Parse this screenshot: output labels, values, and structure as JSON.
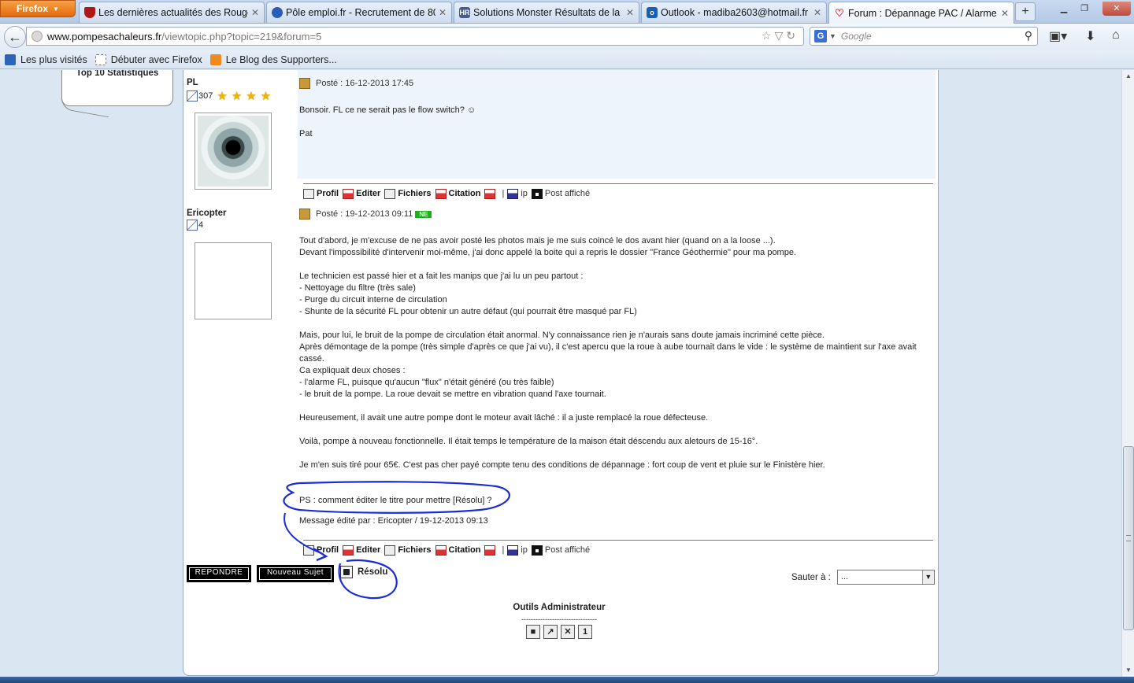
{
  "browser": {
    "menu_label": "Firefox",
    "tabs": [
      {
        "title": "Les dernières actualités des Rouge ...",
        "icon": "shield-red"
      },
      {
        "title": "Pôle emploi.fr - Recrutement de 80...",
        "icon": "page-blue"
      },
      {
        "title": "Solutions Monster Résultats de la r...",
        "icon": "hr-badge",
        "icon_text": "HR"
      },
      {
        "title": "Outlook - madiba2603@hotmail.fr",
        "icon": "outlook-icon",
        "icon_text": "o"
      },
      {
        "title": "Forum : Dépannage PAC / Alarme ...",
        "icon": "heart-icon",
        "active": true
      }
    ],
    "new_tab": "+",
    "url_domain": "www.pompesachaleurs.fr",
    "url_path": "/viewtopic.php?topic=219&forum=5",
    "search_placeholder": "Google",
    "search_engine_icon": "G",
    "bookmarks": [
      "Les plus visités",
      "Débuter avec Firefox",
      "Le Blog des Supporters..."
    ]
  },
  "sidebar_note": "Top 10  Statistiques",
  "posts": [
    {
      "author": "PL",
      "post_count": "307",
      "stars": 4,
      "posted": "Posté : 16-12-2013 17:45",
      "body": [
        "Bonsoir. FL ce ne serait pas le flow switch? ☺",
        "",
        "Pat"
      ]
    },
    {
      "author": "Ericopter",
      "post_count": "4",
      "posted": "Posté : 19-12-2013 09:11",
      "badge": "NE",
      "body": [
        "Tout d'abord, je m'excuse de ne pas avoir posté les photos mais je me suis coincé le dos avant hier (quand on a la loose ...).",
        "Devant l'impossibilité d'intervenir moi-même, j'ai donc appelé la boite qui a repris le dossier \"France Géothermie\" pour ma pompe.",
        "",
        "Le technicien est passé hier et a fait les manips que j'ai lu un peu partout :",
        "- Nettoyage du filtre (très sale)",
        "- Purge du circuit interne de circulation",
        "- Shunte de la sécurité FL pour obtenir un autre défaut (qui pourrait être masqué par FL)",
        "",
        "Mais, pour lui, le bruit de la pompe de circulation était anormal. N'y connaissance rien je n'aurais sans doute jamais incriminé cette pièce.",
        "Après démontage de la pompe (très simple d'après ce que j'ai vu), il c'est apercu que la roue à aube tournait dans le vide : le système de maintient sur l'axe avait",
        "cassé.",
        "Ca expliquait deux choses :",
        "- l'alarme FL, puisque qu'aucun \"flux\" n'était généré (ou très faible)",
        "- le bruit de la pompe. La roue devait se mettre en vibration quand l'axe tournait.",
        "",
        "Heureusement, il avait une autre pompe dont le moteur avait lâché : il a juste remplacé la roue défecteuse.",
        "",
        "Voilà, pompe à nouveau fonctionnelle. Il était temps le température de la maison était déscendu aux aletours de 15-16°.",
        "",
        "Je m'en suis tiré pour 65€. C'est pas cher payé compte tenu des conditions de dépannage : fort coup de vent et pluie sur le Finistère hier."
      ],
      "ps": "PS : comment éditer le titre pour mettre [Résolu] ?",
      "edited": "Message édité par : Ericopter / 19-12-2013 09:13"
    }
  ],
  "post_toolbar": {
    "profil": "Profil",
    "editer": "Editer",
    "fichiers": "Fichiers",
    "citation": "Citation",
    "sep": "|",
    "ip": "ip",
    "post_affiche": "Post affiché"
  },
  "actions": {
    "reply": "REPONDRE",
    "new_topic": "Nouveau  Sujet",
    "resolved": "Résolu",
    "jump_label": "Sauter à :",
    "jump_value": "..."
  },
  "admin": {
    "title": "Outils Administrateur",
    "dashes": "--------------------------------",
    "icons": [
      "lock-icon",
      "move-icon",
      "delete-icon",
      "split-icon"
    ]
  },
  "colors": {
    "annotation": "#1a2bd8",
    "post_bg_highlight": "#eef4fb"
  }
}
